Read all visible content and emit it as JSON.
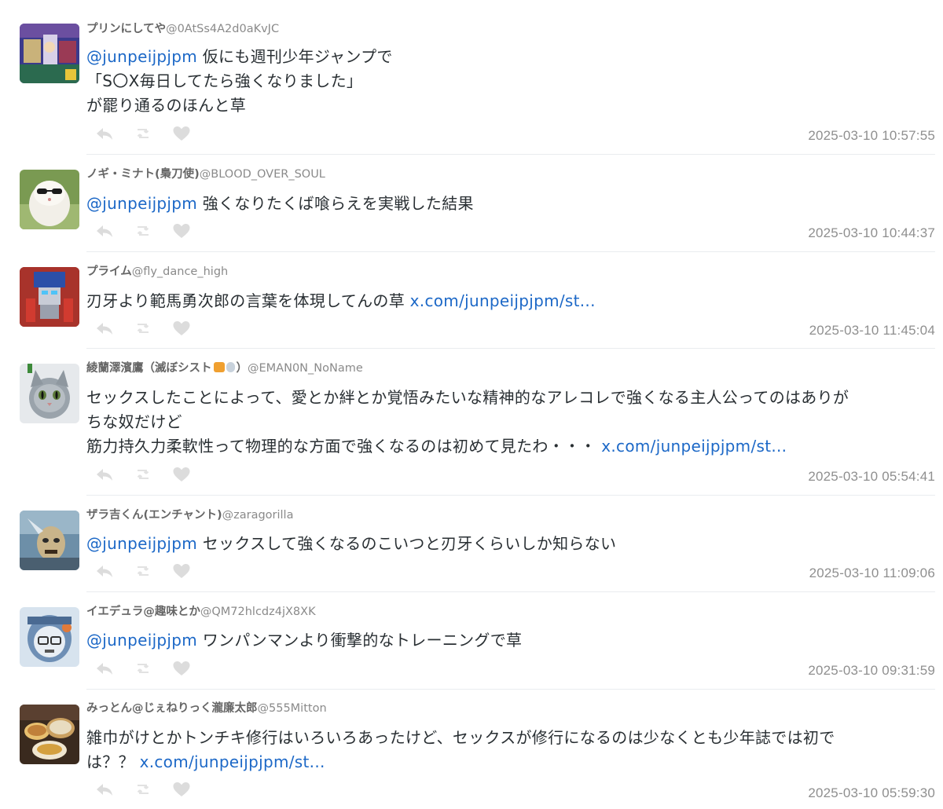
{
  "colors": {
    "link": "#1c68c7",
    "text": "#292f33",
    "meta": "#8f8f8f",
    "action_icon": "#dcdcdc"
  },
  "tweets": [
    {
      "display_name": "プリンにしてや",
      "screen_name": "@0AtSs4A2d0aKvJC",
      "mention": "@junpeijpjpm",
      "text_line1": " 仮にも週刊少年ジャンプで",
      "text_line2": "「S〇X毎日してたら強くなりました」",
      "text_line3": "が罷り通るのほんと草",
      "timestamp": "2025-03-10 10:57:55"
    },
    {
      "display_name": "ノギ・ミナト(梟刀使)",
      "screen_name": "@BLOOD_OVER_SOUL",
      "mention": "@junpeijpjpm",
      "text": " 強くなりたくば喰らえを実戦した結果",
      "timestamp": "2025-03-10 10:44:37"
    },
    {
      "display_name": "プライム",
      "screen_name": "@fly_dance_high",
      "text": "刃牙より範馬勇次郎の言葉を体現してんの草 ",
      "link": "x.com/junpeijpjpm/st...",
      "timestamp": "2025-03-10 11:45:04"
    },
    {
      "display_name": "綾蘭澤濱鷹（滅ぼシスト",
      "display_name_suffix": "）",
      "screen_name": "@EMAN0N_NoName",
      "text_line1": "セックスしたことによって、愛とか絆とか覚悟みたいな精神的なアレコレで強くなる主人公ってのはありが",
      "text_line2": "ちな奴だけど",
      "text_line3": "筋力持久力柔軟性って物理的な方面で強くなるのは初めて見たわ・・・ ",
      "link": "x.com/junpeijpjpm/st...",
      "timestamp": "2025-03-10 05:54:41"
    },
    {
      "display_name": "ザラ吉くん(エンチャント)",
      "screen_name": "@zaragorilla",
      "mention": "@junpeijpjpm",
      "text": " セックスして強くなるのこいつと刃牙くらいしか知らない",
      "timestamp": "2025-03-10 11:09:06"
    },
    {
      "display_name": "イエデュラ@趣味とか",
      "screen_name": "@QM72hlcdz4jX8XK",
      "mention": "@junpeijpjpm",
      "text": " ワンパンマンより衝撃的なトレーニングで草",
      "timestamp": "2025-03-10 09:31:59"
    },
    {
      "display_name": "みっとん@じぇねりっく瀧廉太郎",
      "screen_name": "@555Mitton",
      "text_line1": "雑巾がけとかトンチキ修行はいろいろあったけど、セックスが修行になるのは少なくとも少年誌では初で",
      "text_line2": "は？？ ",
      "link": "x.com/junpeijpjpm/st...",
      "timestamp": "2025-03-10 05:59:30"
    }
  ],
  "icons": {
    "reply": "reply-icon",
    "retweet": "retweet-icon",
    "like": "heart-icon"
  }
}
